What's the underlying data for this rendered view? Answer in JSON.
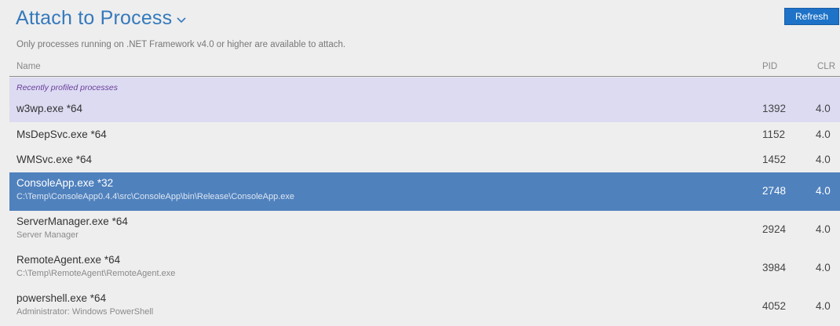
{
  "header": {
    "title": "Attach to Process",
    "refresh_label": "Refresh",
    "subtitle": "Only processes running on .NET Framework v4.0 or higher are available to attach."
  },
  "columns": {
    "name": "Name",
    "pid": "PID",
    "clr": "CLR"
  },
  "recent_group": {
    "label": "Recently profiled processes",
    "rows": [
      {
        "name": "w3wp.exe *64",
        "pid": "1392",
        "clr": "4.0"
      }
    ]
  },
  "processes": [
    {
      "name": "MsDepSvc.exe *64",
      "desc": "",
      "pid": "1152",
      "clr": "4.0"
    },
    {
      "name": "WMSvc.exe *64",
      "desc": "",
      "pid": "1452",
      "clr": "4.0"
    },
    {
      "name": "ConsoleApp.exe *32",
      "desc": "C:\\Temp\\ConsoleApp0.4.4\\src\\ConsoleApp\\bin\\Release\\ConsoleApp.exe",
      "pid": "2748",
      "clr": "4.0",
      "selected": true
    },
    {
      "name": "ServerManager.exe *64",
      "desc": "Server Manager",
      "pid": "2924",
      "clr": "4.0"
    },
    {
      "name": "RemoteAgent.exe *64",
      "desc": "C:\\Temp\\RemoteAgent\\RemoteAgent.exe",
      "pid": "3984",
      "clr": "4.0"
    },
    {
      "name": "powershell.exe *64",
      "desc": "Administrator: Windows PowerShell",
      "pid": "4052",
      "clr": "4.0"
    }
  ],
  "colors": {
    "accent": "#3579bc",
    "selected": "#4f81bd",
    "recent_bg": "#dcdbf2",
    "button": "#1e72c7"
  },
  "icons": {
    "title_dropdown": "chevron-down-icon"
  }
}
